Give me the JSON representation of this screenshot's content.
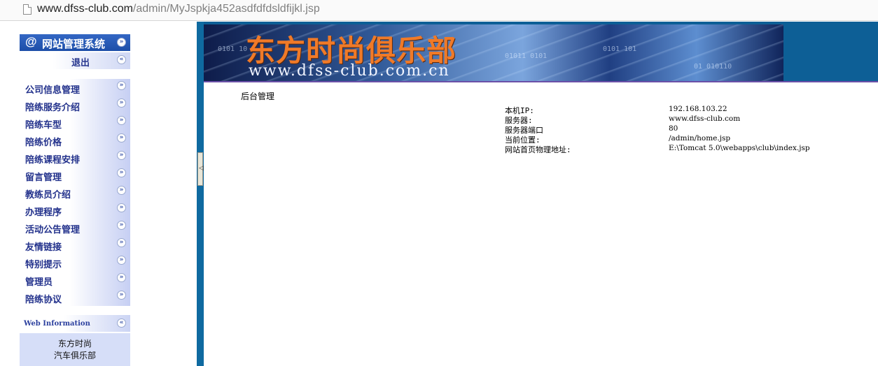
{
  "browser": {
    "url_host": "www.dfss-club.com",
    "url_path": "/admin/MyJspkja452asdfdfdsldfijkl.jsp"
  },
  "sidebar": {
    "brand_at": "@",
    "brand_title": "网站管理系统",
    "logout_label": "退出",
    "menu_items": [
      {
        "label": "公司信息管理"
      },
      {
        "label": "陪练服务介绍"
      },
      {
        "label": "陪练车型"
      },
      {
        "label": "陪练价格"
      },
      {
        "label": "陪练课程安排"
      },
      {
        "label": "留言管理"
      },
      {
        "label": "教练员介绍"
      },
      {
        "label": "办理程序"
      },
      {
        "label": "活动公告管理"
      },
      {
        "label": "友情链接"
      },
      {
        "label": "特别提示"
      },
      {
        "label": "管理员"
      },
      {
        "label": "陪练协议"
      }
    ],
    "web_info_title": "Web Information",
    "web_info_line1": "东方时尚",
    "web_info_line2": "汽车俱乐部"
  },
  "banner": {
    "site_name": "东方时尚俱乐部",
    "site_url": "www.dfss-club.com.cn",
    "binary_1": "0101 10",
    "binary_2": "01011 0101",
    "binary_3": "0101 101",
    "binary_4": "01 010110"
  },
  "content": {
    "title": "后台管理",
    "info": [
      {
        "key": "本机IP:",
        "value": "192.168.103.22"
      },
      {
        "key": "服务器:",
        "value": "www.dfss-club.com"
      },
      {
        "key": "服务器端口",
        "value": "80"
      },
      {
        "key": "当前位置:",
        "value": "/admin/home.jsp"
      },
      {
        "key": "网站首页物理地址:",
        "value": "E:\\Tomcat 5.0\\webapps\\club\\index.jsp"
      }
    ]
  },
  "colors": {
    "brand_blue": "#1d4ea8",
    "menu_text": "#23328c",
    "splitter": "#0f6aa0",
    "banner_orange": "#f07a28"
  }
}
